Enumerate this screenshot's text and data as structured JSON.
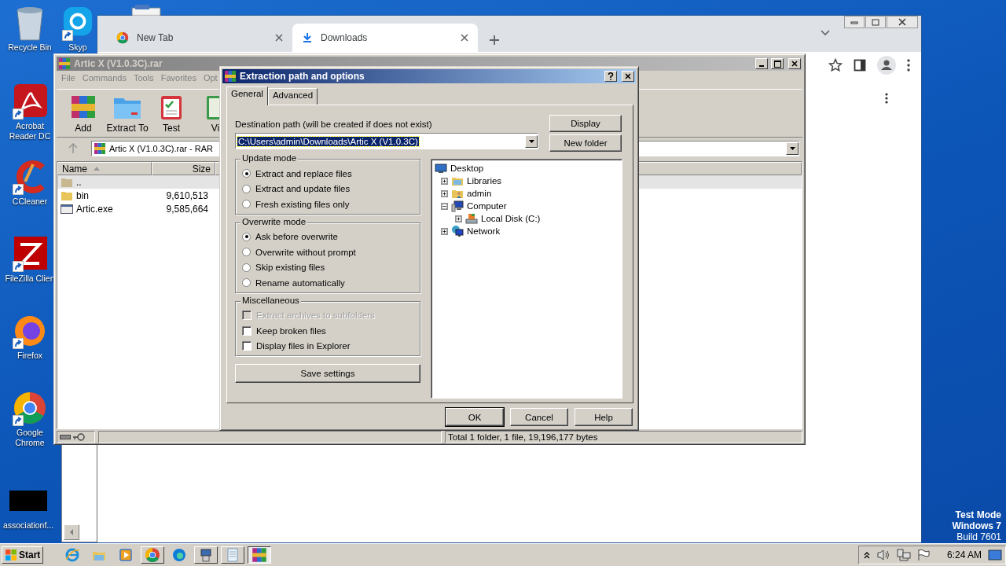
{
  "desktop": {
    "icons": [
      {
        "label": "Recycle Bin",
        "kind": "recycle",
        "shortcut": false
      },
      {
        "label": "Skyp",
        "kind": "skype",
        "shortcut": true
      },
      {
        "label": "Acrobat Reader DC",
        "kind": "acrobat",
        "shortcut": true
      },
      {
        "label": "CCleaner",
        "kind": "ccleaner",
        "shortcut": true
      },
      {
        "label": "FileZilla Clien",
        "kind": "filezilla",
        "shortcut": true
      },
      {
        "label": "Firefox",
        "kind": "firefox",
        "shortcut": true
      },
      {
        "label": "Google Chrome",
        "kind": "chrome",
        "shortcut": true
      },
      {
        "label": "associationf...",
        "kind": "black",
        "shortcut": false
      }
    ],
    "os_notice": [
      "Test Mode",
      "Windows 7",
      "Build 7601"
    ]
  },
  "browser": {
    "tabs": [
      {
        "label": "New Tab",
        "kind": "chrome",
        "selected": false
      },
      {
        "label": "Downloads",
        "kind": "download",
        "selected": true
      }
    ]
  },
  "winrar": {
    "title": "Artic X (V1.0.3C).rar",
    "menu": [
      "File",
      "Commands",
      "Tools",
      "Favorites",
      "Opt"
    ],
    "toolbar": [
      {
        "label": "Add",
        "kind": "add"
      },
      {
        "label": "Extract To",
        "kind": "extract"
      },
      {
        "label": "Test",
        "kind": "test"
      },
      {
        "label": "Vi",
        "kind": "view"
      }
    ],
    "address": "Artic X (V1.0.3C).rar - RAR",
    "columns": [
      "Name",
      "Size"
    ],
    "rows": [
      {
        "name": "..",
        "kind": "up",
        "selected": true
      },
      {
        "name": "bin",
        "kind": "folder",
        "size": "9,610,513",
        "selected": false
      },
      {
        "name": "Artic.exe",
        "kind": "exe",
        "size": "9,585,664",
        "selected": false
      }
    ],
    "status": "Total 1 folder, 1 file, 19,196,177 bytes"
  },
  "dialog": {
    "title": "Extraction path and options",
    "tabs": [
      {
        "label": "General",
        "selected": true
      },
      {
        "label": "Advanced",
        "selected": false
      }
    ],
    "path_label": "Destination path (will be created if does not exist)",
    "path": {
      "value": "C:\\Users\\admin\\Downloads\\Artic X (V1.0.3C)",
      "selected": true
    },
    "side_buttons": [
      "Display",
      "New folder"
    ],
    "groups": [
      {
        "title": "Update mode",
        "kind": "radio",
        "options": [
          {
            "label": "Extract and replace files",
            "selected": true
          },
          {
            "label": "Extract and update files",
            "selected": false
          },
          {
            "label": "Fresh existing files only",
            "selected": false
          }
        ]
      },
      {
        "title": "Overwrite mode",
        "kind": "radio",
        "options": [
          {
            "label": "Ask before overwrite",
            "selected": true
          },
          {
            "label": "Overwrite without prompt",
            "selected": false
          },
          {
            "label": "Skip existing files",
            "selected": false
          },
          {
            "label": "Rename automatically",
            "selected": false
          }
        ]
      },
      {
        "title": "Miscellaneous",
        "kind": "check",
        "options": [
          {
            "label": "Extract archives to subfolders",
            "checked": false,
            "disabled": true
          },
          {
            "label": "Keep broken files",
            "checked": false,
            "disabled": false
          },
          {
            "label": "Display files in Explorer",
            "checked": false,
            "disabled": false
          }
        ]
      }
    ],
    "save_button": "Save settings",
    "tree": {
      "label": "Desktop",
      "kind": "desktop",
      "children": [
        {
          "label": "Libraries",
          "kind": "libraries",
          "expanded": false
        },
        {
          "label": "admin",
          "kind": "user",
          "expanded": false
        },
        {
          "label": "Computer",
          "kind": "computer",
          "expanded": true,
          "children": [
            {
              "label": "Local Disk (C:)",
              "kind": "disk",
              "expanded": false
            }
          ]
        },
        {
          "label": "Network",
          "kind": "network",
          "expanded": false
        }
      ]
    },
    "buttons": [
      {
        "label": "OK",
        "default": true
      },
      {
        "label": "Cancel",
        "default": false
      },
      {
        "label": "Help",
        "default": false
      }
    ]
  },
  "taskbar": {
    "start": "Start",
    "items": [
      {
        "kind": "ie",
        "running": false,
        "active": false
      },
      {
        "kind": "explorer",
        "running": false,
        "active": false
      },
      {
        "kind": "media",
        "running": false,
        "active": false
      },
      {
        "kind": "chrome",
        "running": true,
        "active": false
      },
      {
        "kind": "edge",
        "running": false,
        "active": false
      },
      {
        "kind": "installer",
        "running": true,
        "active": false
      },
      {
        "kind": "notepad",
        "running": true,
        "active": false
      },
      {
        "kind": "winrar",
        "running": true,
        "active": true
      }
    ],
    "clock": "6:24 AM"
  }
}
